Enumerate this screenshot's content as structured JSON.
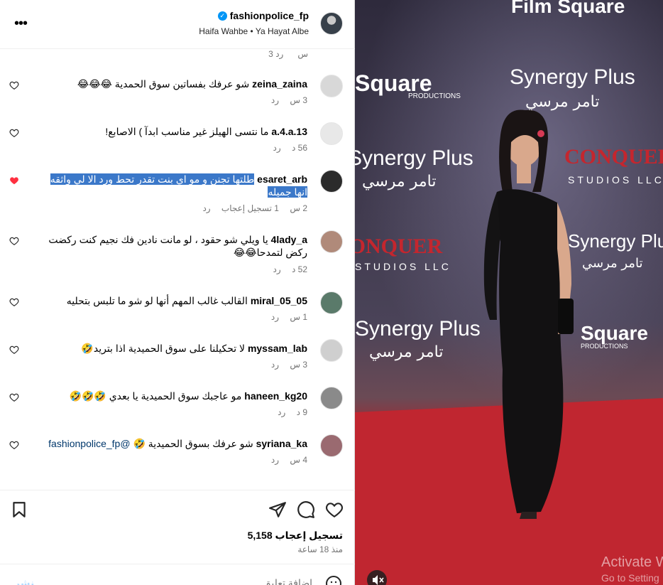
{
  "header": {
    "username": "fashionpolice_fp",
    "audio": "Haifa Wahbe • Ya Hayat Albe",
    "more_icon": "more-horizontal-icon"
  },
  "top_meta": {
    "time": "3 س",
    "reply": "رد"
  },
  "comments": [
    {
      "user": "zeina_zaina",
      "text": "شو عرفك بفساتين سوق الحمدية 😂😂😂",
      "time": "3 س",
      "likes": "",
      "reply": "رد",
      "liked": false,
      "avatar_color": "#d8d8d8"
    },
    {
      "user": "a.4.a.13",
      "text": "ما نتسى الهيلز غير مناسب ابدآ ) الاصابع!",
      "time": "56 د",
      "likes": "",
      "reply": "رد",
      "liked": false,
      "avatar_color": "#e8e8e8"
    },
    {
      "user": "esaret_arb",
      "text": "طلتها تجنن و مو اي بنت تقدر تحط ورد الا لي واثقه انها جميله",
      "time": "2 س",
      "likes": "1 تسجيل إعجاب",
      "reply": "رد",
      "liked": true,
      "avatar_color": "#2b2b2b"
    },
    {
      "user": "4lady_a",
      "text": "يا ويلي شو حقود ، لو مانت نادين فك نجيم كنت ركضت ركض لتمدحا😂😂",
      "time": "52 د",
      "likes": "",
      "reply": "رد",
      "liked": false,
      "avatar_color": "#b08a7a"
    },
    {
      "user": "miral_05_05",
      "text": "القالب غالب المهم أنها لو شو ما تلبس بتحليه",
      "time": "1 س",
      "likes": "",
      "reply": "رد",
      "liked": false,
      "avatar_color": "#5a7a6a"
    },
    {
      "user": "myssam_lab",
      "text": "لا تحكيلنا على سوق الحميدية اذا بتريد🤣",
      "time": "3 س",
      "likes": "",
      "reply": "رد",
      "liked": false,
      "avatar_color": "#cfcfcf"
    },
    {
      "user": "haneen_kg20",
      "text": "مو عاجبك سوق الحميدية يا بعدي 🤣🤣🤣",
      "time": "9 د",
      "likes": "",
      "reply": "رد",
      "liked": false,
      "avatar_color": "#8a8a8a"
    },
    {
      "user": "syriana_ka",
      "text": "شو عرفك بسوق الحميدية 🤣",
      "mention": "@fashionpolice_fp",
      "time": "4 س",
      "likes": "",
      "reply": "رد",
      "liked": false,
      "avatar_color": "#9a6a70"
    }
  ],
  "actions": {
    "likes_count": "5,158 تسجيل إعجاب",
    "posted": "منذ 18 ساعة"
  },
  "add_comment": {
    "placeholder": "إضافة تعليق...",
    "post_label": "نشر"
  },
  "media": {
    "sign_top": "Film Square",
    "sign_productions": "PRODUCTIONS",
    "sign_synergy": "Synergy Plus",
    "sign_arabic": "تامر مرسي",
    "sign_conquer": "CONQUER",
    "sign_studios": "STUDIOS LLC",
    "sign_square": "Square",
    "activate_title": "Activate W",
    "activate_sub": "Go to Setting"
  },
  "colors": {
    "like_red": "#ff3040",
    "highlight": "#3b78c9",
    "verified": "#0095f6"
  }
}
